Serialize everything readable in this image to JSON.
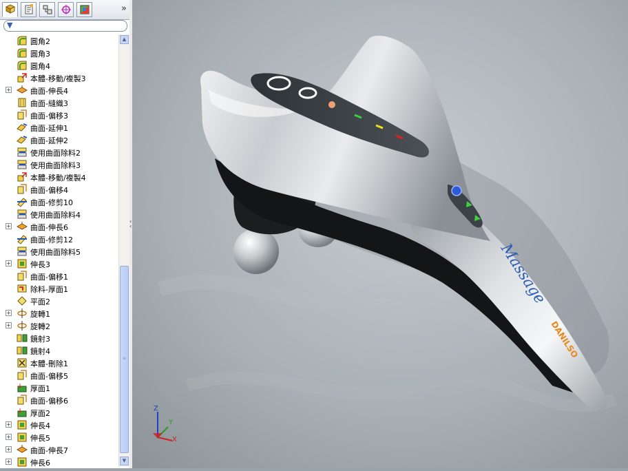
{
  "toolbar": {
    "tabs": [
      {
        "name": "feature-manager-tab",
        "icon": "feature-tree-icon"
      },
      {
        "name": "property-manager-tab",
        "icon": "property-icon"
      },
      {
        "name": "configuration-manager-tab",
        "icon": "configuration-icon"
      },
      {
        "name": "dimxpert-manager-tab",
        "icon": "target-icon"
      },
      {
        "name": "display-manager-tab",
        "icon": "display-icon"
      }
    ],
    "more_label": "»",
    "filter_icon": "filter-icon"
  },
  "tree": {
    "items": [
      {
        "label": "圓角2",
        "icon": "fillet",
        "expand": false
      },
      {
        "label": "圓角3",
        "icon": "fillet",
        "expand": false
      },
      {
        "label": "圓角4",
        "icon": "fillet",
        "expand": false
      },
      {
        "label": "本體-移動/複製3",
        "icon": "move",
        "expand": false
      },
      {
        "label": "曲面-伸長4",
        "icon": "surface-extrude",
        "expand": true
      },
      {
        "label": "曲面-縫織3",
        "icon": "knit",
        "expand": false
      },
      {
        "label": "曲面-偏移3",
        "icon": "offset",
        "expand": false
      },
      {
        "label": "曲面-延伸1",
        "icon": "extend",
        "expand": false
      },
      {
        "label": "曲面-延伸2",
        "icon": "extend",
        "expand": false
      },
      {
        "label": "使用曲面除料2",
        "icon": "surface-cut",
        "expand": false
      },
      {
        "label": "使用曲面除料3",
        "icon": "surface-cut",
        "expand": false
      },
      {
        "label": "本體-移動/複製4",
        "icon": "move",
        "expand": false
      },
      {
        "label": "曲面-偏移4",
        "icon": "offset",
        "expand": false
      },
      {
        "label": "曲面-修剪10",
        "icon": "trim",
        "expand": false
      },
      {
        "label": "使用曲面除料4",
        "icon": "surface-cut",
        "expand": false
      },
      {
        "label": "曲面-伸長6",
        "icon": "surface-extrude",
        "expand": true
      },
      {
        "label": "曲面-修剪12",
        "icon": "trim",
        "expand": false
      },
      {
        "label": "使用曲面除料5",
        "icon": "surface-cut",
        "expand": false
      },
      {
        "label": "伸長3",
        "icon": "extrude",
        "expand": true
      },
      {
        "label": "曲面-偏移1",
        "icon": "offset",
        "expand": false
      },
      {
        "label": "除料-厚面1",
        "icon": "cut-thicken",
        "expand": false
      },
      {
        "label": "平面2",
        "icon": "plane",
        "expand": false
      },
      {
        "label": "旋轉1",
        "icon": "revolve",
        "expand": true
      },
      {
        "label": "旋轉2",
        "icon": "revolve",
        "expand": true
      },
      {
        "label": "鏡射3",
        "icon": "mirror",
        "expand": false
      },
      {
        "label": "鏡射4",
        "icon": "mirror",
        "expand": false
      },
      {
        "label": "本體-刪除1",
        "icon": "delete-body",
        "expand": false
      },
      {
        "label": "曲面-偏移5",
        "icon": "offset",
        "expand": false
      },
      {
        "label": "厚面1",
        "icon": "thicken",
        "expand": false
      },
      {
        "label": "曲面-偏移6",
        "icon": "offset",
        "expand": false
      },
      {
        "label": "厚面2",
        "icon": "thicken",
        "expand": false
      },
      {
        "label": "伸長4",
        "icon": "extrude",
        "expand": true
      },
      {
        "label": "伸長5",
        "icon": "extrude",
        "expand": true
      },
      {
        "label": "曲面-伸長7",
        "icon": "surface-extrude",
        "expand": true
      },
      {
        "label": "伸長6",
        "icon": "extrude",
        "expand": true
      }
    ]
  },
  "model": {
    "brand_text": "Massage",
    "sub_text": "DANILSO"
  },
  "triad": {
    "x": "X",
    "y": "Y",
    "z": "Z"
  },
  "colors": {
    "accent": "#3b5fae",
    "model_label": "#2c5db3",
    "brand_orange": "#e8871e"
  }
}
